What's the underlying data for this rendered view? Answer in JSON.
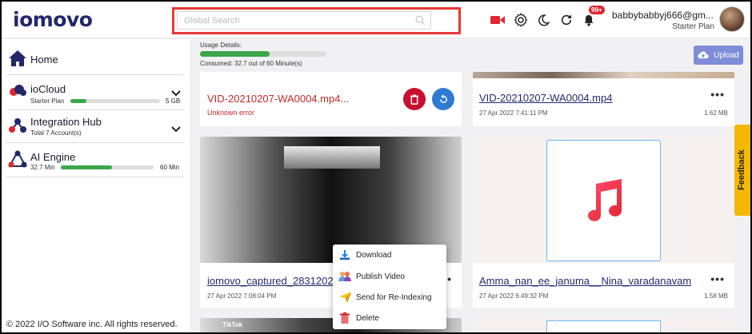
{
  "header": {
    "logo": "iomovo",
    "search_placeholder": "Global Search",
    "notification_count": "99+",
    "user_email": "babbybabbyj666@gm...",
    "user_plan": "Starter Plan"
  },
  "sidebar": {
    "home_label": "Home",
    "iocloud": {
      "label": "ioCloud",
      "plan": "Starter Plan",
      "value": "5 GB",
      "fill_pct": 18
    },
    "integration": {
      "label": "Integration Hub",
      "sub": "Total 7 Account(s)"
    },
    "ai_engine": {
      "label": "AI Engine",
      "used": "32.7 Min",
      "total": "60 Min",
      "fill_pct": 55
    },
    "footer": "© 2022 I/O Software inc. All rights reserved."
  },
  "usage": {
    "label": "Usage Details:",
    "consumed": "Consumed: 32.7 out of 60 Minute(s)",
    "fill_pct": 55
  },
  "upload_label": "Upload",
  "cards": [
    {
      "title": "VID-20210207-WA0004.mp4...",
      "status": "Unknown error"
    },
    {
      "title": "VID-20210207-WA0004.mp4",
      "date": "27 Apr 2022 7:41:11 PM",
      "size": "1.62 MB"
    },
    {
      "title": "iomovo_captured_2831202",
      "date": "27 Apr 2022 7:08:04 PM"
    },
    {
      "title": "Amma_nan_ee_januma__Nina_varadanavam...",
      "date": "27 Apr 2022 6:49:32 PM",
      "size": "1.58 MB"
    }
  ],
  "tiktok_label": "TikTok",
  "context_menu": {
    "download": "Download",
    "publish": "Publish Video",
    "reindex": "Send for Re-Indexing",
    "delete": "Delete"
  },
  "feedback_label": "Feedback",
  "colors": {
    "brand_navy": "#23286b",
    "brand_red": "#e0262f",
    "progress_green": "#3aa648",
    "upload_purple": "#7f8cd8",
    "feedback_yellow": "#f5b800"
  }
}
